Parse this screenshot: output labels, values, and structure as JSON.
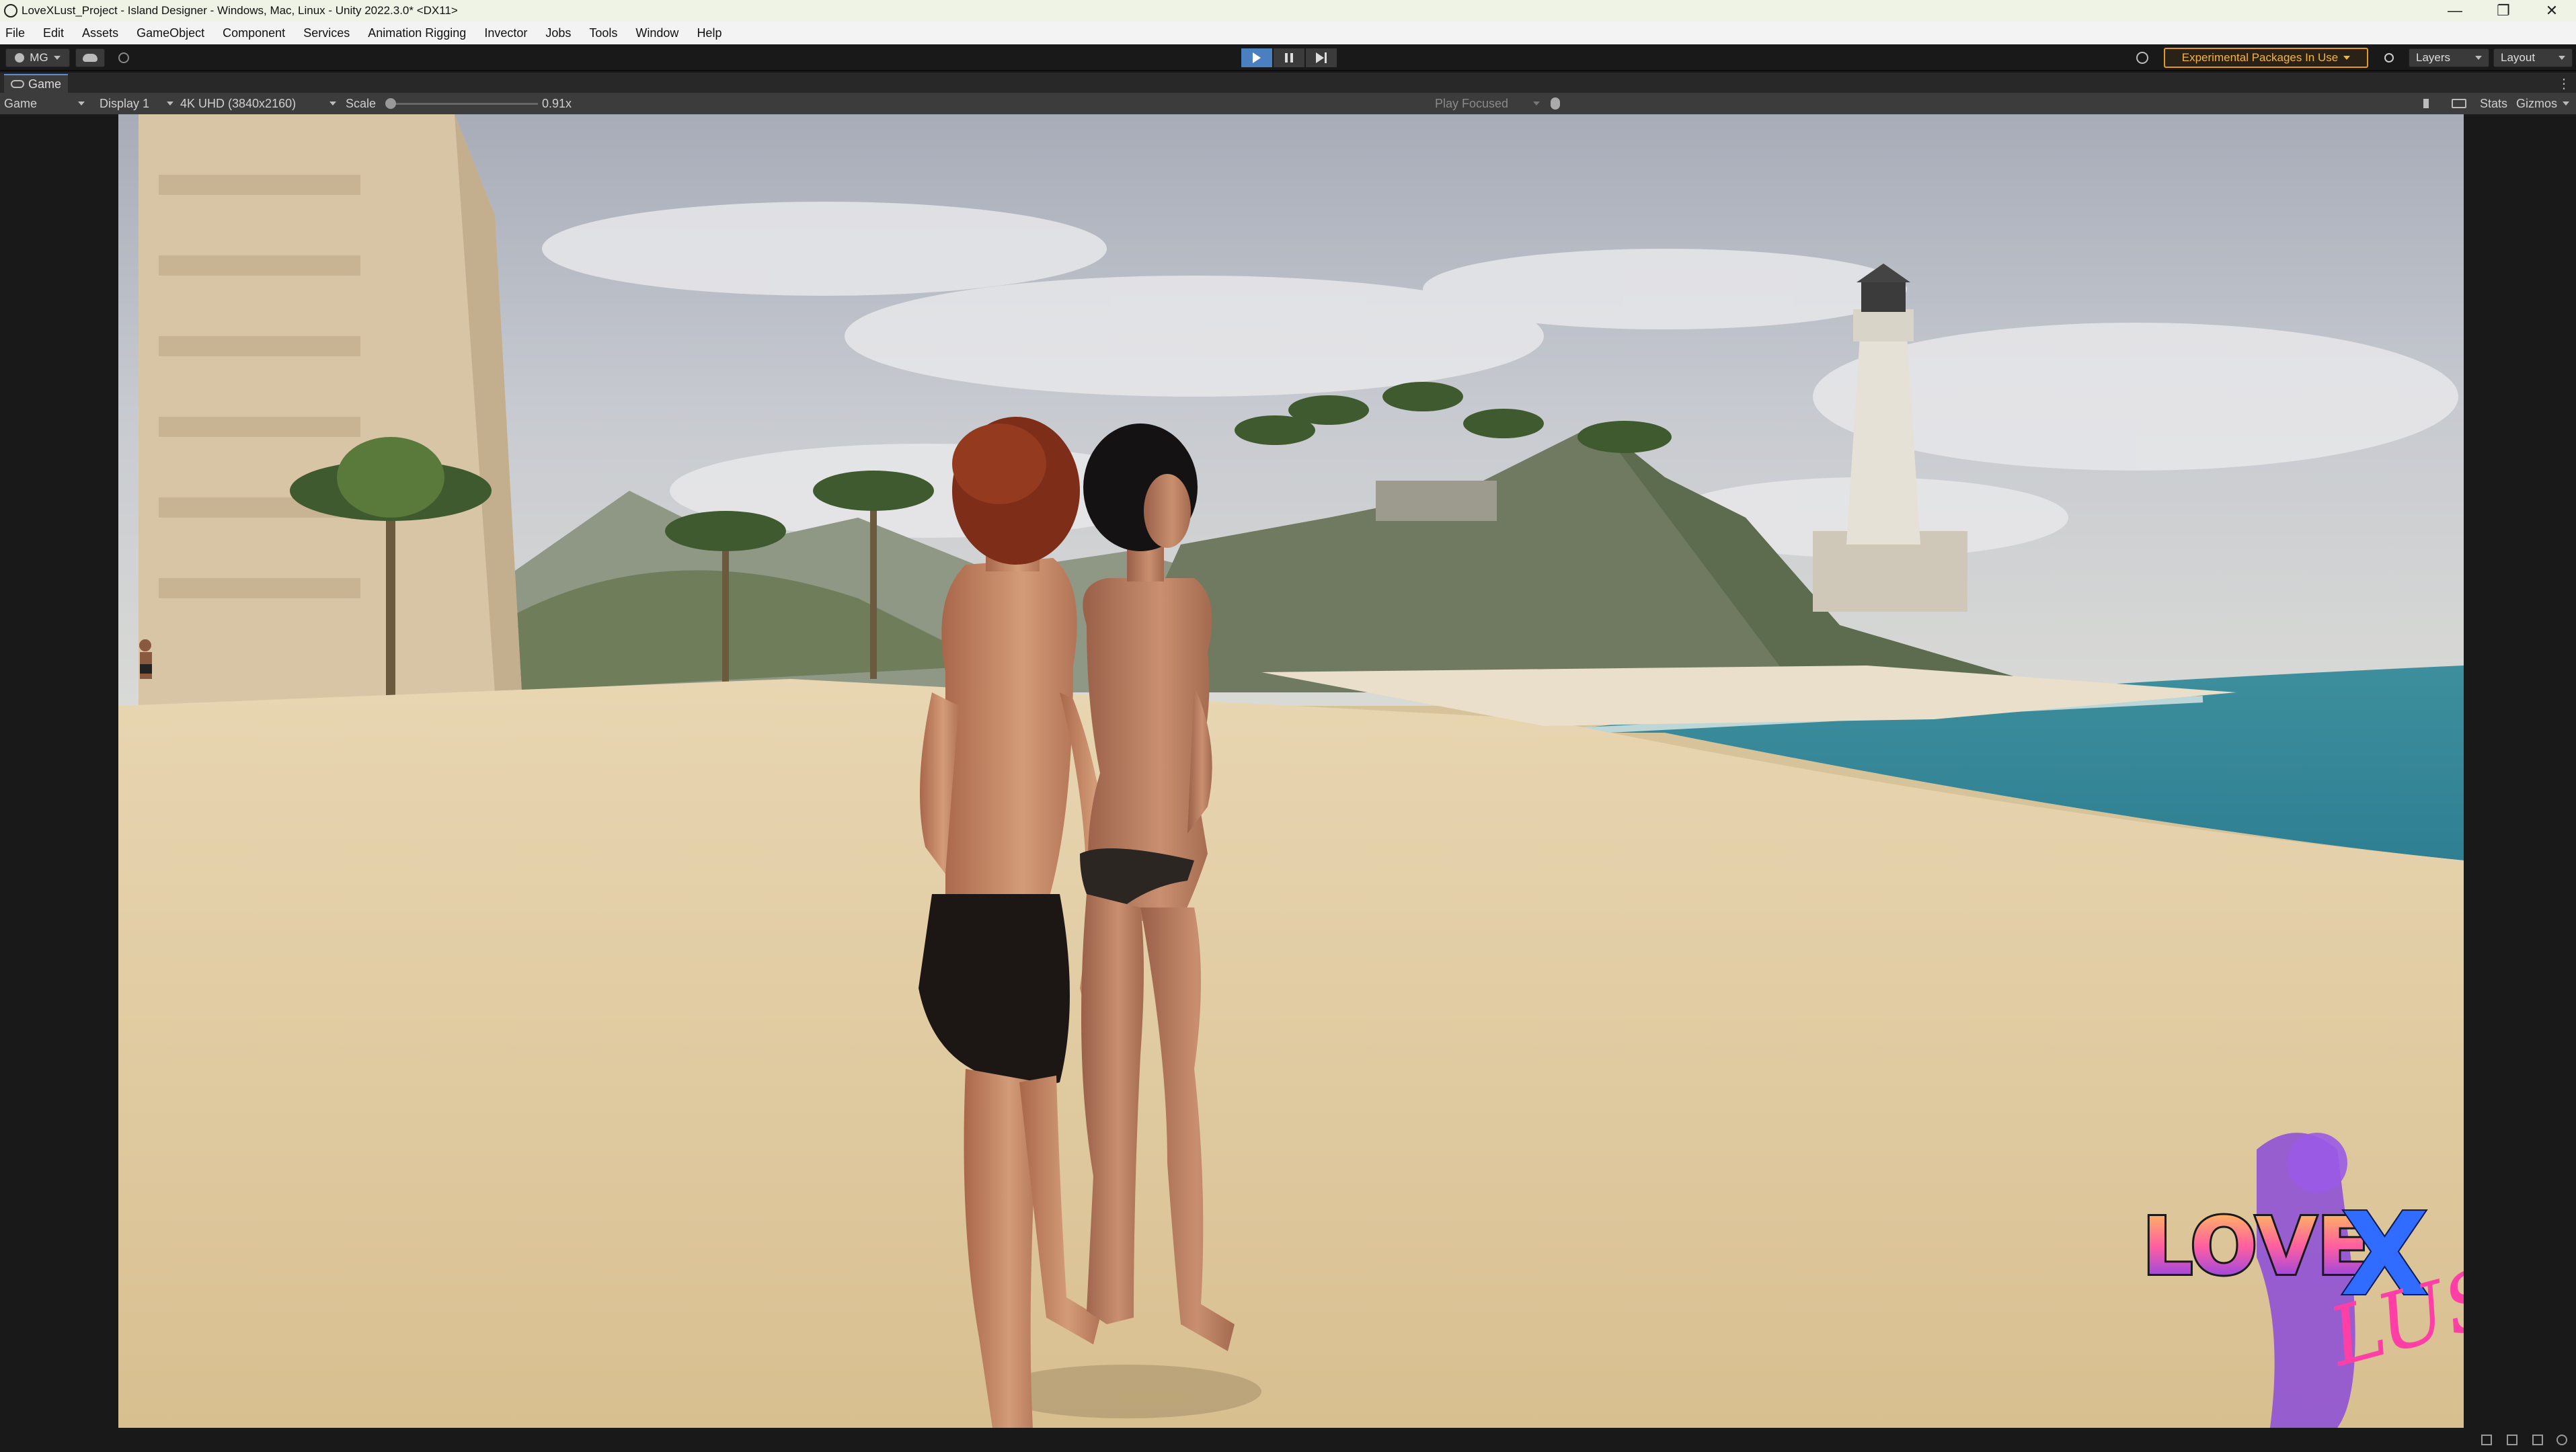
{
  "window": {
    "title": "LoveXLust_Project - Island Designer - Windows, Mac, Linux - Unity 2022.3.0* <DX11>",
    "controls": {
      "minimize": "—",
      "maximize": "❐",
      "close": "✕"
    }
  },
  "menu": [
    "File",
    "Edit",
    "Assets",
    "GameObject",
    "Component",
    "Services",
    "Animation Rigging",
    "Invector",
    "Jobs",
    "Tools",
    "Window",
    "Help"
  ],
  "toolbar": {
    "account_label": "MG",
    "experimental_label": "Experimental Packages In Use",
    "layers_label": "Layers",
    "layout_label": "Layout",
    "play_state": "playing"
  },
  "game_tab": {
    "label": "Game"
  },
  "game_bar": {
    "mode": "Game",
    "display": "Display 1",
    "resolution": "4K UHD (3840x2160)",
    "scale_label": "Scale",
    "scale_value": "0.91x",
    "play_focused": "Play Focused",
    "stats_label": "Stats",
    "gizmos_label": "Gizmos"
  },
  "viewport": {
    "logo": {
      "text_left": "LOVE",
      "text_x": "X",
      "text_right": "LUST"
    }
  },
  "colors": {
    "accent_blue": "#4a7fc0",
    "warning_orange": "#e59a1c",
    "logo_pink": "#ff3fa6",
    "logo_blue": "#2f6cff"
  }
}
